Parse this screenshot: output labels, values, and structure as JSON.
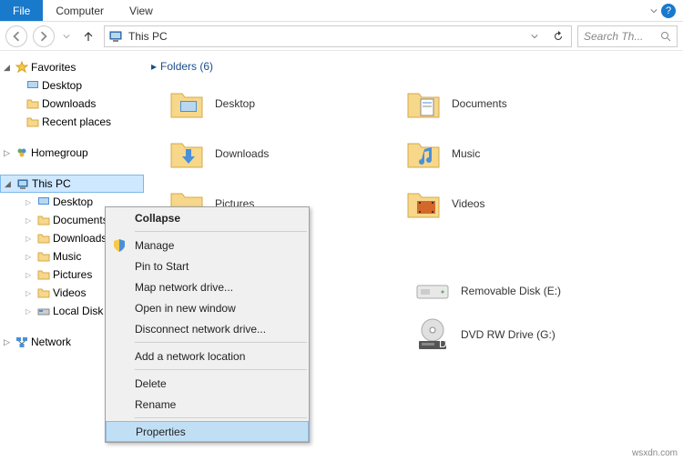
{
  "ribbon": {
    "file": "File",
    "tabs": [
      "Computer",
      "View"
    ]
  },
  "nav": {
    "address": "This PC",
    "search_placeholder": "Search Th..."
  },
  "tree": {
    "favorites": {
      "label": "Favorites",
      "items": [
        "Desktop",
        "Downloads",
        "Recent places"
      ]
    },
    "homegroup": "Homegroup",
    "thispc": {
      "label": "This PC",
      "items": [
        "Desktop",
        "Documents",
        "Downloads",
        "Music",
        "Pictures",
        "Videos",
        "Local Disk (..."
      ]
    },
    "network": "Network"
  },
  "content": {
    "folders_header": "Folders (6)",
    "folders": [
      "Desktop",
      "Documents",
      "Downloads",
      "Music",
      "Pictures",
      "Videos"
    ],
    "drives": [
      "Removable Disk (E:)",
      "DVD RW Drive (G:)"
    ]
  },
  "context_menu": {
    "collapse": "Collapse",
    "manage": "Manage",
    "pin": "Pin to Start",
    "map": "Map network drive...",
    "open": "Open in new window",
    "disconnect": "Disconnect network drive...",
    "add": "Add a network location",
    "delete": "Delete",
    "rename": "Rename",
    "properties": "Properties"
  },
  "watermark": "wsxdn.com"
}
